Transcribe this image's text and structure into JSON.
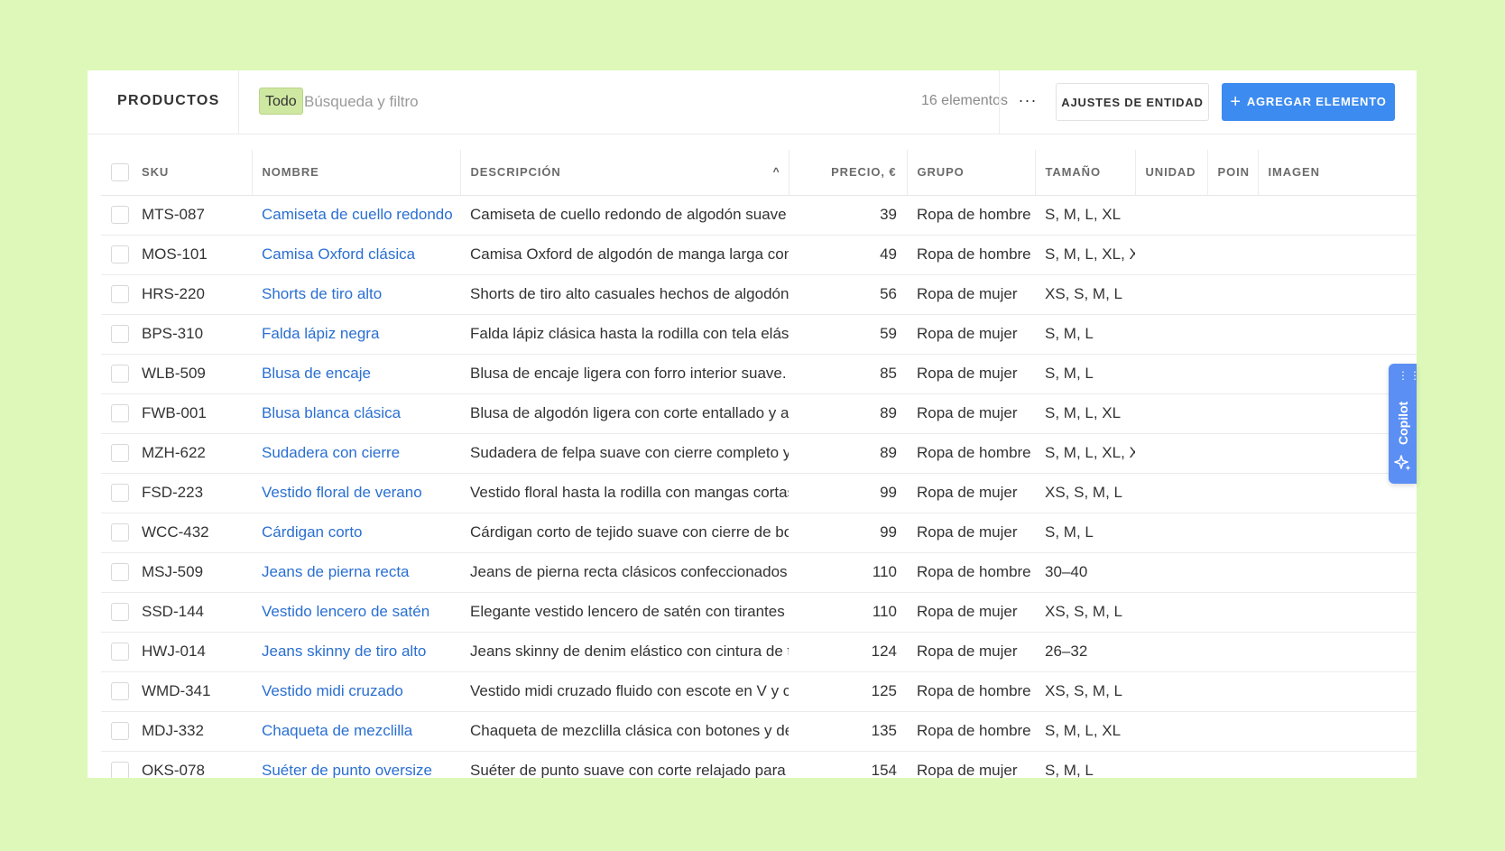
{
  "toolbar": {
    "title": "PRODUCTOS",
    "filter_chip": "Todo",
    "search_placeholder": "Búsqueda y filtro",
    "count": "16 elementos",
    "more_label": "···",
    "settings_label": "AJUSTES DE ENTIDAD",
    "add_label": "AGREGAR ELEMENTO",
    "add_icon": "plus-icon",
    "primary_color": "#3c8bf0"
  },
  "table": {
    "columns": [
      "SKU",
      "NOMBRE",
      "DESCRIPCIÓN",
      "PRECIO, €",
      "GRUPO",
      "TAMAÑO",
      "UNIDAD",
      "POIN",
      "IMAGEN"
    ],
    "sort_indicator": "^",
    "rows": [
      {
        "sku": "MTS-087",
        "name": "Camiseta de cuello redondo",
        "desc": "Camiseta de cuello redondo de algodón suave diseñada pa",
        "price": "39",
        "group": "Ropa de hombre",
        "size": "S, M, L, XL"
      },
      {
        "sku": "MOS-101",
        "name": "Camisa Oxford clásica",
        "desc": "Camisa Oxford de algodón de manga larga con corte regul",
        "price": "49",
        "group": "Ropa de hombre",
        "size": "S, M, L, XL, XXL"
      },
      {
        "sku": "HRS-220",
        "name": "Shorts de tiro alto",
        "desc": "Shorts de tiro alto casuales hechos de algodón transpirabl",
        "price": "56",
        "group": "Ropa de mujer",
        "size": "XS, S, M, L"
      },
      {
        "sku": "BPS-310",
        "name": "Falda lápiz negra",
        "desc": "Falda lápiz clásica hasta la rodilla con tela elástica.",
        "price": "59",
        "group": "Ropa de mujer",
        "size": "S, M, L"
      },
      {
        "sku": "WLB-509",
        "name": "Blusa de encaje",
        "desc": "Blusa de encaje ligera con forro interior suave.",
        "price": "85",
        "group": "Ropa de mujer",
        "size": "S, M, L"
      },
      {
        "sku": "FWB-001",
        "name": "Blusa blanca clásica",
        "desc": "Blusa de algodón ligera con corte entallado y acabado pe",
        "price": "89",
        "group": "Ropa de mujer",
        "size": "S, M, L, XL"
      },
      {
        "sku": "MZH-622",
        "name": "Sudadera con cierre",
        "desc": "Sudadera de felpa suave con cierre completo y capucha a",
        "price": "89",
        "group": "Ropa de hombre",
        "size": "S, M, L, XL, XXL"
      },
      {
        "sku": "FSD-223",
        "name": "Vestido floral de verano",
        "desc": "Vestido floral hasta la rodilla con mangas cortas y ajuste",
        "price": "99",
        "group": "Ropa de mujer",
        "size": "XS, S, M, L"
      },
      {
        "sku": "WCC-432",
        "name": "Cárdigan corto",
        "desc": "Cárdigan corto de tejido suave con cierre de botones.",
        "price": "99",
        "group": "Ropa de mujer",
        "size": "S, M, L"
      },
      {
        "sku": "MSJ-509",
        "name": "Jeans de pierna recta",
        "desc": "Jeans de pierna recta clásicos confeccionados con denim",
        "price": "110",
        "group": "Ropa de hombre",
        "size": "30–40"
      },
      {
        "sku": "SSD-144",
        "name": "Vestido lencero de satén",
        "desc": "Elegante vestido lencero de satén con tirantes ajustables.",
        "price": "110",
        "group": "Ropa de mujer",
        "size": "XS, S, M, L"
      },
      {
        "sku": "HWJ-014",
        "name": "Jeans skinny de tiro alto",
        "desc": "Jeans skinny de denim elástico con cintura de tiro alto y",
        "price": "124",
        "group": "Ropa de mujer",
        "size": "26–32"
      },
      {
        "sku": "WMD-341",
        "name": "Vestido midi cruzado",
        "desc": "Vestido midi cruzado fluido con escote en V y cinturón aju",
        "price": "125",
        "group": "Ropa de hombre",
        "size": "XS, S, M, L"
      },
      {
        "sku": "MDJ-332",
        "name": "Chaqueta de mezclilla",
        "desc": "Chaqueta de mezclilla clásica con botones y denim de grc",
        "price": "135",
        "group": "Ropa de hombre",
        "size": "S, M, L, XL"
      },
      {
        "sku": "OKS-078",
        "name": "Suéter de punto oversize",
        "desc": "Suéter de punto suave con corte relajado para uso diarios",
        "price": "154",
        "group": "Ropa de mujer",
        "size": "S, M, L"
      }
    ]
  },
  "copilot": {
    "label": "Copilot",
    "icons": [
      "grip-dots-icon",
      "sparkle-icon"
    ],
    "color": "#5b8ff4"
  }
}
